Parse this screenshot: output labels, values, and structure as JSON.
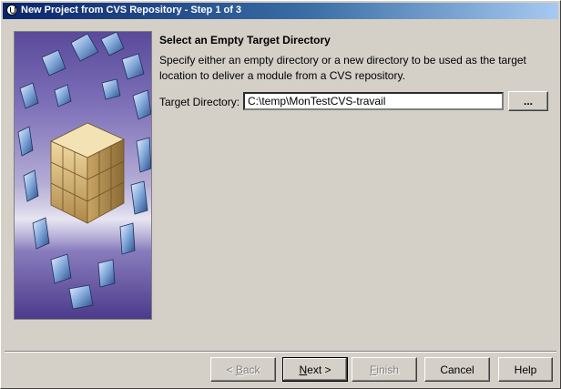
{
  "window": {
    "title": "New Project from CVS Repository - Step 1 of 3"
  },
  "content": {
    "heading": "Select an Empty Target Directory",
    "description": "Specify either an empty directory or a new directory to be used as the target location to deliver a module from a CVS repository.",
    "target_label": "Target Directory:",
    "target_value": "C:\\temp\\MonTestCVS-travail",
    "browse_label": "..."
  },
  "buttons": {
    "back_mnemonic": "B",
    "back_rest": "ack",
    "back_prefix": "< ",
    "next_mnemonic": "N",
    "next_rest": "ext >",
    "finish_mnemonic": "F",
    "finish_rest": "inish",
    "cancel": "Cancel",
    "help": "Help"
  },
  "colors": {
    "titlebar_start": "#0a246a",
    "titlebar_end": "#a6caf0",
    "window_bg": "#d4d0c8"
  }
}
